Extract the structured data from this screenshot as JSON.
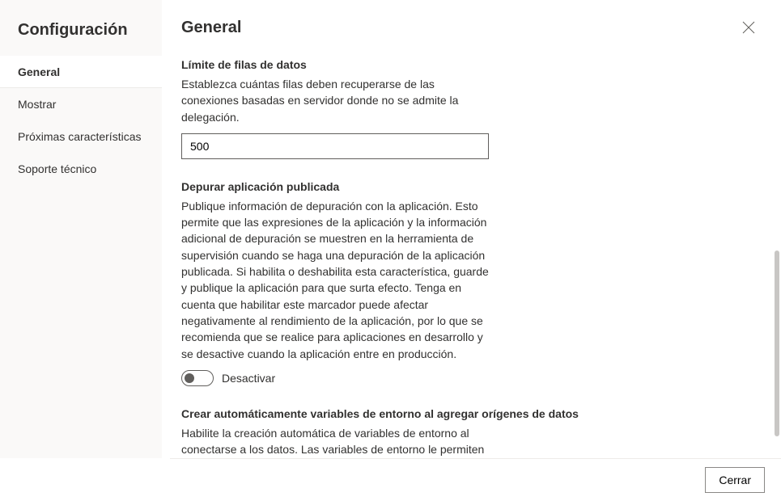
{
  "sidebar": {
    "title": "Configuración",
    "items": [
      {
        "label": "General",
        "selected": true
      },
      {
        "label": "Mostrar",
        "selected": false
      },
      {
        "label": "Próximas características",
        "selected": false
      },
      {
        "label": "Soporte técnico",
        "selected": false
      }
    ]
  },
  "header": {
    "title": "General"
  },
  "sections": {
    "dataRowLimit": {
      "title": "Límite de filas de datos",
      "desc": "Establezca cuántas filas deben recuperarse de las conexiones basadas en servidor donde no se admite la delegación.",
      "value": "500"
    },
    "debugPublished": {
      "title": "Depurar aplicación publicada",
      "desc": "Publique información de depuración con la aplicación. Esto permite que las expresiones de la aplicación y la información adicional de depuración se muestren en la herramienta de supervisión cuando se haga una depuración de la aplicación publicada. Si habilita o deshabilita esta característica, guarde y publique la aplicación para que surta efecto. Tenga en cuenta que habilitar este marcador puede afectar negativamente al rendimiento de la aplicación, por lo que se recomienda que se realice para aplicaciones en desarrollo y se desactive cuando la aplicación entre en producción.",
      "toggleLabel": "Desactivar",
      "toggleOn": false
    },
    "autoEnvVars": {
      "title": "Crear automáticamente variables de entorno al agregar orígenes de datos",
      "desc": "Habilite la creación automática de variables de entorno al conectarse a los datos. Las variables de entorno le permiten cambiar orígenes de datos dentro de las soluciones."
    }
  },
  "footer": {
    "closeLabel": "Cerrar"
  }
}
